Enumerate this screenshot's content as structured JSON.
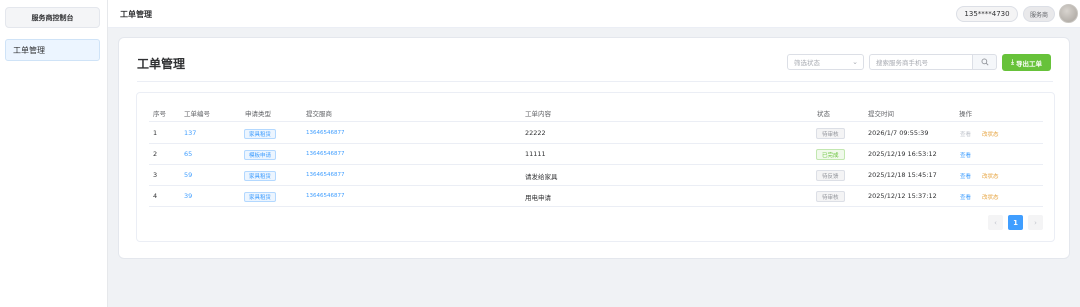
{
  "sidebar": {
    "brand": "服务商控制台",
    "items": [
      {
        "label": "工单管理",
        "active": true
      }
    ]
  },
  "topbar": {
    "title": "工单管理",
    "phone": "135****4730",
    "role": "服务商"
  },
  "card": {
    "title": "工单管理",
    "filter_placeholder": "筛选状态",
    "search_placeholder": "搜索服务商手机号",
    "export_label": "导出工单"
  },
  "table": {
    "columns": [
      "序号",
      "工单编号",
      "申请类型",
      "提交服商",
      "工单内容",
      "状态",
      "提交时间",
      "操作"
    ],
    "rows": [
      {
        "index": "1",
        "id": "137",
        "type": "家具租赁",
        "submitter": "13646546877",
        "content": "22222",
        "status": "待审核",
        "time": "2026/1/7 09:55:39",
        "view": "查看",
        "change": "改状态"
      },
      {
        "index": "2",
        "id": "65",
        "type": "模板申请",
        "submitter": "13646546877",
        "content": "11111",
        "status": "已完成",
        "time": "2025/12/19 16:53:12",
        "view": "查看",
        "change": ""
      },
      {
        "index": "3",
        "id": "59",
        "type": "家具租赁",
        "submitter": "13646546877",
        "content": "请发给家具",
        "status": "待反馈",
        "time": "2025/12/18 15:45:17",
        "view": "查看",
        "change": "改状态"
      },
      {
        "index": "4",
        "id": "39",
        "type": "家具租赁",
        "submitter": "13646546877",
        "content": "用电申请",
        "status": "待审核",
        "time": "2025/12/12 15:37:12",
        "view": "查看",
        "change": "改状态"
      }
    ]
  },
  "pagination": {
    "prev": "‹",
    "current": "1",
    "next": "›"
  },
  "colors": {
    "primary": "#409eff",
    "success": "#67c23a",
    "warning": "#e6a23c"
  },
  "icons": {
    "search": "search-icon",
    "select": "chevron-down-icon",
    "export": "download-icon"
  }
}
